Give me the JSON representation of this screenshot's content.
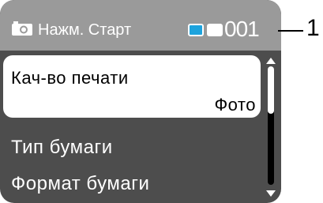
{
  "header": {
    "icon": "camera-icon",
    "title": "Нажм. Старт",
    "counter": "001",
    "ink_colors": [
      "#1da3dd",
      "#ffffff"
    ]
  },
  "callout": {
    "number": "1"
  },
  "menu": {
    "selected": {
      "label": "Кач-во печати",
      "value": "Фото"
    },
    "items": [
      {
        "label": "Тип бумаги"
      },
      {
        "label": "Формат бумаги"
      }
    ]
  },
  "scrollbar": {
    "position_fraction": 0.0
  }
}
